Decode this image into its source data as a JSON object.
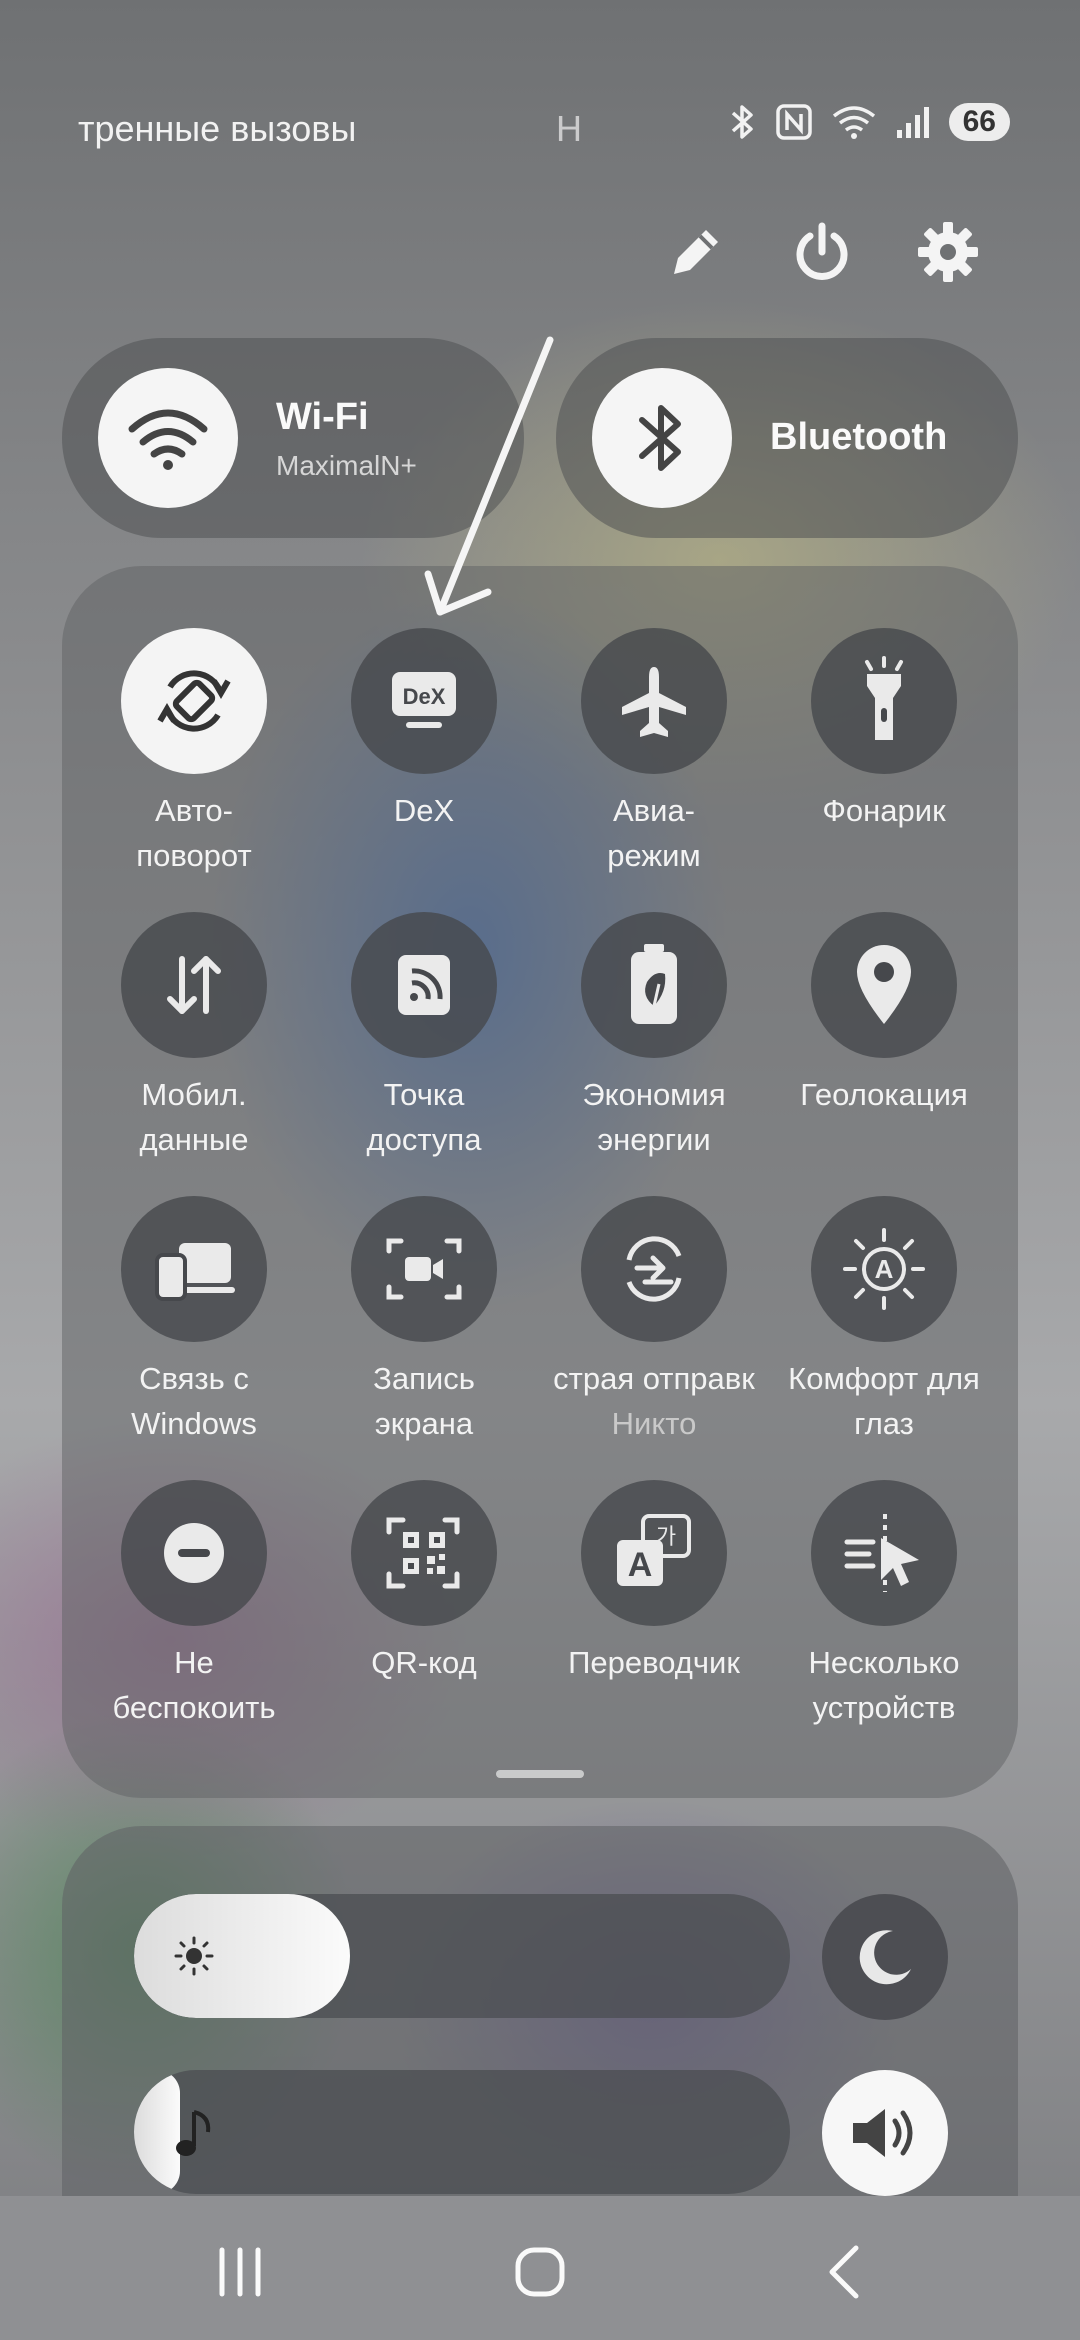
{
  "status_bar": {
    "left_text": "тренные вызовы",
    "center_text": "Н",
    "battery": "66"
  },
  "top_actions": [
    {
      "icon": "pencil-icon"
    },
    {
      "icon": "power-icon"
    },
    {
      "icon": "gear-icon"
    }
  ],
  "wifi": {
    "title": "Wi-Fi",
    "network": "MaximalN+",
    "icon": "wifi-icon"
  },
  "bluetooth": {
    "title": "Bluetooth",
    "icon": "bluetooth-icon"
  },
  "tiles": [
    {
      "l1": "Авто-",
      "l2": "поворот",
      "icon": "auto-rotate-icon",
      "on": true
    },
    {
      "l1": "DeX",
      "l2": "",
      "icon": "dex-icon",
      "on": false
    },
    {
      "l1": "Авиа-",
      "l2": "режим",
      "icon": "airplane-icon",
      "on": false
    },
    {
      "l1": "Фонарик",
      "l2": "",
      "icon": "flashlight-icon",
      "on": false
    },
    {
      "l1": "Мобил.",
      "l2": "данные",
      "icon": "mobile-data-icon",
      "on": false
    },
    {
      "l1": "Точка",
      "l2": "доступа",
      "icon": "hotspot-icon",
      "on": false
    },
    {
      "l1": "Экономия",
      "l2": "энергии",
      "icon": "power-saving-icon",
      "on": false
    },
    {
      "l1": "Геолокация",
      "l2": "",
      "icon": "location-icon",
      "on": false
    },
    {
      "l1": "Связь с",
      "l2": "Windows",
      "icon": "link-windows-icon",
      "on": false
    },
    {
      "l1": "Запись",
      "l2": "экрана",
      "icon": "screen-record-icon",
      "on": false
    },
    {
      "l1": "страя отправк",
      "l2": "Никто",
      "icon": "quick-share-icon",
      "on": false
    },
    {
      "l1": "Комфорт для",
      "l2": "глаз",
      "icon": "eye-comfort-icon",
      "on": false
    },
    {
      "l1": "Не",
      "l2": "беспокоить",
      "icon": "do-not-disturb-icon",
      "on": false
    },
    {
      "l1": "QR-код",
      "l2": "",
      "icon": "qr-code-icon",
      "on": false
    },
    {
      "l1": "Переводчик",
      "l2": "",
      "icon": "translator-icon",
      "on": false
    },
    {
      "l1": "Несколько",
      "l2": "устройств",
      "icon": "multi-device-icon",
      "on": false
    }
  ],
  "brightness": {
    "level_percent": 33,
    "icon": "sun-icon"
  },
  "media_volume": {
    "level_percent": 7,
    "icon": "music-note-icon"
  },
  "night_mode": {
    "icon": "moon-icon"
  },
  "sound_mode": {
    "icon": "speaker-icon"
  },
  "nav": [
    {
      "icon": "recents-icon"
    },
    {
      "icon": "home-icon"
    },
    {
      "icon": "back-icon"
    }
  ],
  "colors": {
    "accent_on": "#f4f4f4",
    "tile_off": "#46484c",
    "text": "#f3f3f3"
  }
}
